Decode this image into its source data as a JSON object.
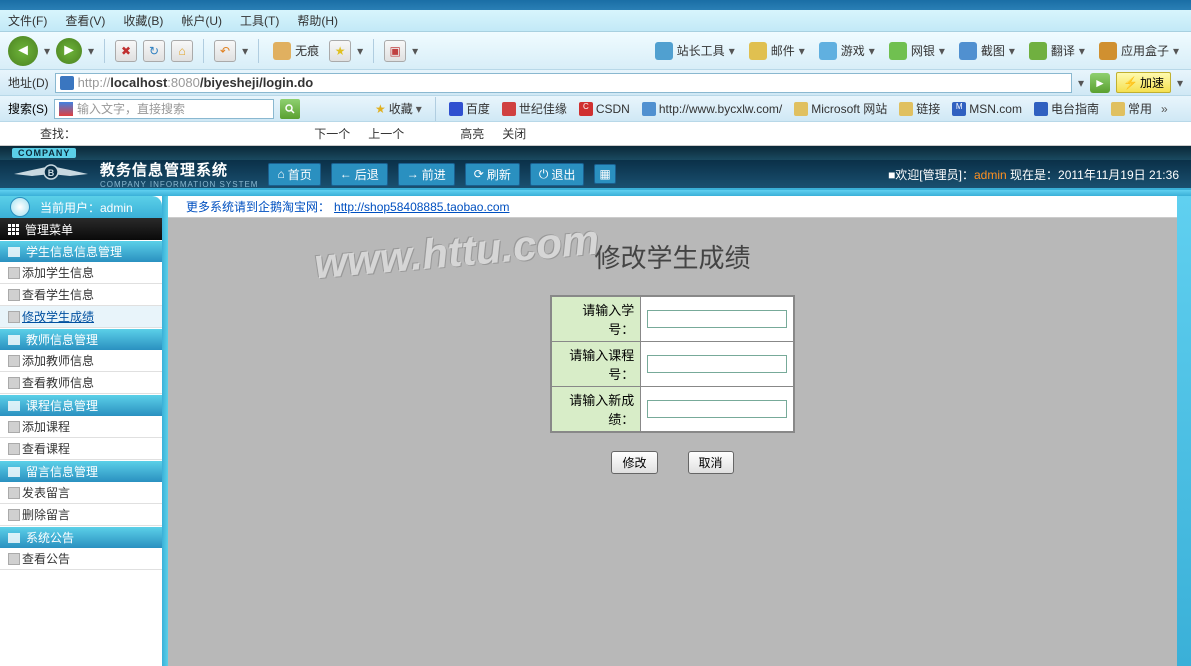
{
  "browser": {
    "menus": [
      "文件(F)",
      "查看(V)",
      "收藏(B)",
      "帐户(U)",
      "工具(T)",
      "帮助(H)"
    ],
    "toolbar": {
      "wuhen": "无痕",
      "zhanzhang": "站长工具",
      "youjian": "邮件",
      "youxi": "游戏",
      "wangyin": "网银",
      "jietu": "截图",
      "fanyi": "翻译",
      "yingyong": "应用盒子"
    },
    "addr_label": "地址(D)",
    "url_prefix": "http://",
    "url_host": "localhost",
    "url_port": ":8080",
    "url_path": "/biyesheji/login.do",
    "accel": "加速",
    "search_label": "搜索(S)",
    "search_ph": "输入文字，直接搜索",
    "fav": "收藏",
    "bookmarks": [
      "百度",
      "世纪佳缘",
      "CSDN",
      "http://www.bycxlw.com/",
      "Microsoft 网站",
      "链接",
      "MSN.com",
      "电台指南",
      "常用"
    ],
    "find_label": "查找：",
    "find_prev": "下一个",
    "find_next": "上一个",
    "find_hl": "高亮",
    "find_close": "关闭"
  },
  "app": {
    "company": "COMPANY",
    "title": "教务信息管理系统",
    "subtitle": "COMPANY INFORMATION SYSTEM",
    "nav": {
      "home": "首页",
      "back": "后退",
      "fwd": "前进",
      "refresh": "刷新",
      "exit": "退出"
    },
    "welcome_pre": "■欢迎[管理员]：",
    "welcome_user": "admin",
    "welcome_time_pre": " 现在是：",
    "welcome_time": "2011年11月19日 21:36"
  },
  "sidebar": {
    "current_user_label": "当前用户：admin",
    "menu_title": "管理菜单",
    "cats": [
      {
        "title": "学生信息信息管理",
        "items": [
          "添加学生信息",
          "查看学生信息",
          "修改学生成绩"
        ]
      },
      {
        "title": "教师信息管理",
        "items": [
          "添加教师信息",
          "查看教师信息"
        ]
      },
      {
        "title": "课程信息管理",
        "items": [
          "添加课程",
          "查看课程"
        ]
      },
      {
        "title": "留言信息管理",
        "items": [
          "发表留言",
          "删除留言"
        ]
      },
      {
        "title": "系统公告",
        "items": [
          "查看公告"
        ]
      }
    ]
  },
  "content": {
    "notice_pre": "更多系统请到企鹅淘宝网：",
    "notice_link": "http://shop58408885.taobao.com",
    "form_title": "修改学生成绩",
    "watermark": "www.httu.com",
    "field1": "请输入学号：",
    "field2": "请输入课程号：",
    "field3": "请输入新成绩：",
    "btn_ok": "修改",
    "btn_cancel": "取消"
  }
}
